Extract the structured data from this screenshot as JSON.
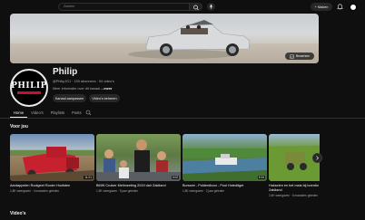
{
  "header": {
    "search_placeholder": "Zoeken",
    "create_label": "+ Maken"
  },
  "banner": {
    "edit_button_label": "Bewerken"
  },
  "channel": {
    "name": "Philip",
    "meta": "@PhilipJG1 · 159 abonnees · 94 video's",
    "description_prefix": "Meer informatie over dit kanaal",
    "description_more": "...meer",
    "avatar_text": "PHILIP",
    "customize_label": "Kanaal aanpassen",
    "manage_label": "Video's beheren"
  },
  "tabs": [
    "Home",
    "Video's",
    "Playlists",
    "Posts"
  ],
  "sections": {
    "for_you": "Voor jou",
    "videos": "Video's"
  },
  "videos": [
    {
      "title": "Aardappelen Rooigeet Rooier Hoofsten",
      "meta": "1,8K weergaven · 4 maanden geleden",
      "duration": "11:01"
    },
    {
      "title": "BMW Cruiser Meilmeeting 2019 dair Zaldland",
      "meta": "1,9K weergaven · 5 jaar geleden",
      "duration": "3:02"
    },
    {
      "title": "Borssee - Polderdboor - Pool Hoteditget",
      "meta": "1,5K weergaven · 2 jaar geleden",
      "duration": "5:34"
    },
    {
      "title": "Hakselen en het mais bij boerdin Zaldland",
      "meta": "2,4K weergaven · 5 maanden geleden",
      "duration": ""
    }
  ],
  "colors": {
    "background": "#0f0f0f",
    "surface": "#272727",
    "text": "#f1f1f1",
    "muted": "#aaaaaa",
    "brand_red": "#c8102e"
  }
}
